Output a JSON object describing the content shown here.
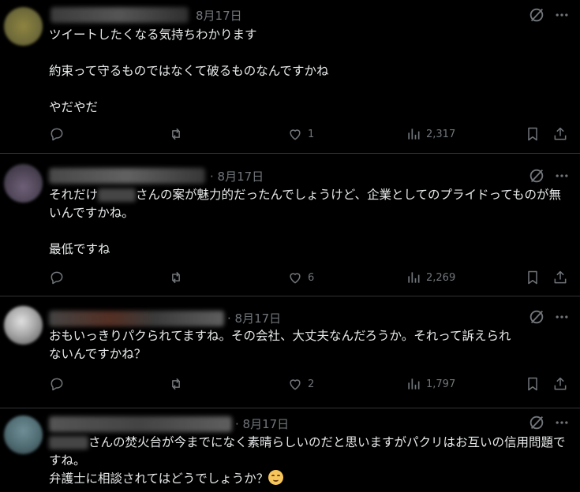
{
  "replies": [
    {
      "date": "8月17日",
      "text": "ツイートしたくなる気持ちわかります\n\n約束って守るものではなくて破るものなんですかね\n\nやだやだ",
      "likes": "1",
      "views": "2,317"
    },
    {
      "date": "· 8月17日",
      "text_parts": [
        "それだけ",
        "さんの案が魅力的だったんでしょうけど、企業としてのプライドってものが無いんですかね。\n\n最低ですね"
      ],
      "likes": "6",
      "views": "2,269"
    },
    {
      "date": "· 8月17日",
      "text": "おもいっきりパクられてますね。その会社、大丈夫なんだろうか。それって訴えられないんですかね？",
      "likes": "2",
      "views": "1,797"
    },
    {
      "date": "· 8月17日",
      "text_parts": [
        "さんの焚火台が今までになく素晴らしいのだと思いますがパクリはお互いの信用問題ですね。\n弁護士に相談されてはどうでしょうか？"
      ],
      "emoji": "☺",
      "likes": "",
      "views": ""
    }
  ],
  "icons": {
    "reply": "reply-icon",
    "repost": "repost-icon",
    "like": "heart-icon",
    "views": "views-chart-icon",
    "bookmark": "bookmark-icon",
    "share": "share-icon",
    "grok": "grok-icon",
    "more": "more-icon"
  }
}
